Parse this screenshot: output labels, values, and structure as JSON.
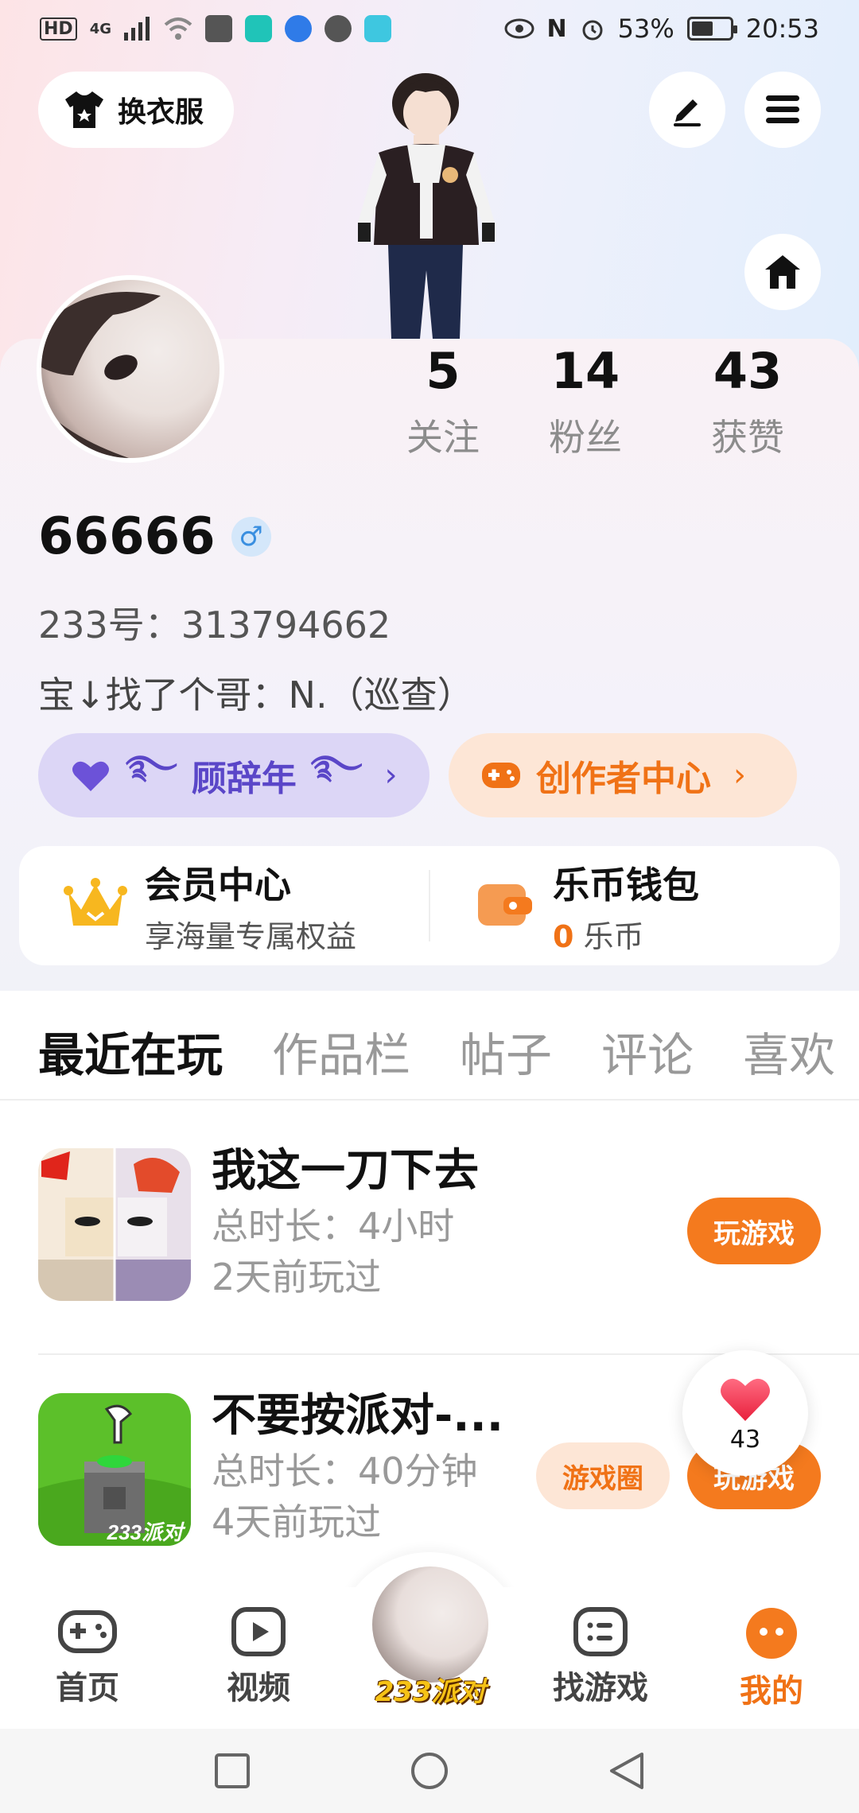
{
  "status_bar": {
    "left_badges": [
      "HD",
      "4G"
    ],
    "battery": "53%",
    "time": "20:53"
  },
  "header": {
    "outfit_button_label": "换衣服"
  },
  "profile": {
    "stats": [
      {
        "value": "5",
        "label": "关注"
      },
      {
        "value": "14",
        "label": "粉丝"
      },
      {
        "value": "43",
        "label": "获赞"
      }
    ],
    "username": "66666",
    "gender_symbol": "♂",
    "uid_line": "233号：313794662",
    "bio": "宝↓找了个哥：N.（巡查）",
    "title_pill": "顾辞年",
    "creator_pill": "创作者中心"
  },
  "member_card": {
    "vip_title": "会员中心",
    "vip_sub": "享海量专属权益",
    "wallet_title": "乐币钱包",
    "wallet_amount": "0",
    "wallet_unit": "乐币"
  },
  "tabs": [
    "最近在玩",
    "作品栏",
    "帖子",
    "评论",
    "喜欢"
  ],
  "games": [
    {
      "name": "我这一刀下去",
      "duration": "总时长：4小时",
      "last_played": "2天前玩过",
      "play_label": "玩游戏"
    },
    {
      "name": "不要按派对-...",
      "duration": "总时长：40分钟",
      "last_played": "4天前玩过",
      "circle_label": "游戏圈",
      "play_label": "玩游戏"
    }
  ],
  "like_bubble": {
    "count": "43"
  },
  "bottom_nav": {
    "items": [
      "首页",
      "视频",
      "找游戏",
      "我的"
    ],
    "center_label": "233派对"
  },
  "colors": {
    "accent": "#f47a1e",
    "purple": "#5a46c8",
    "muted": "#999999"
  }
}
